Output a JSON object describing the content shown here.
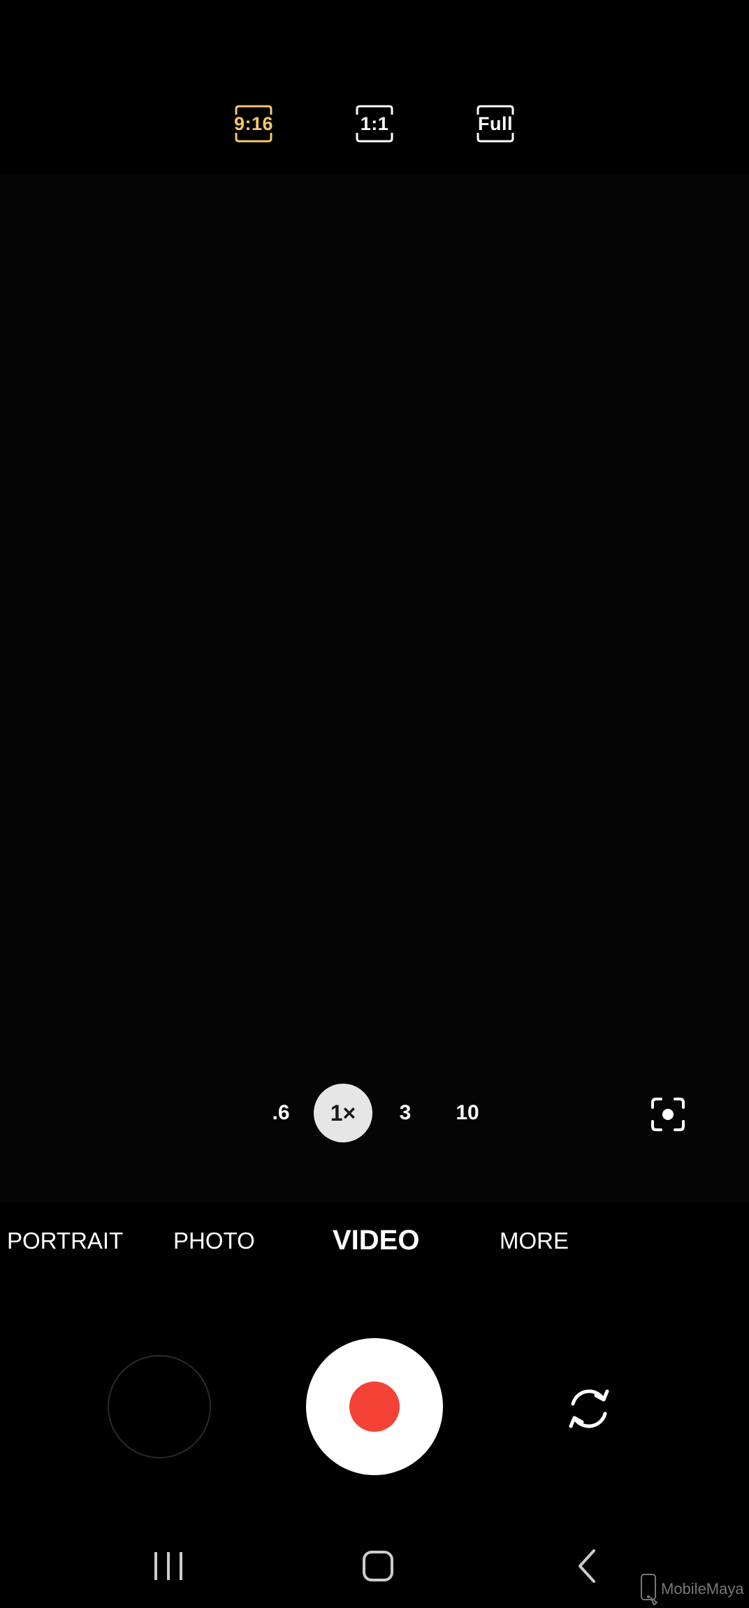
{
  "aspect_ratio": {
    "options": [
      {
        "label": "9:16",
        "selected": true
      },
      {
        "label": "1:1",
        "selected": false
      },
      {
        "label": "Full",
        "selected": false
      }
    ]
  },
  "zoom": {
    "levels": [
      ".6",
      "1×",
      "3",
      "10"
    ],
    "selected": "1×"
  },
  "modes": {
    "items": [
      "PORTRAIT",
      "PHOTO",
      "VIDEO",
      "MORE"
    ],
    "selected": "VIDEO"
  },
  "controls": {
    "record_icon": "record-icon",
    "switch_camera_icon": "switch-camera-icon",
    "focus_icon": "focus-target-icon",
    "gallery_icon": "gallery-thumbnail"
  },
  "navigation": {
    "recents_icon": "recents-icon",
    "home_icon": "home-icon",
    "back_icon": "back-icon"
  },
  "watermark": {
    "text": "MobileMaya"
  },
  "colors": {
    "accent_selected": "#f4c76a",
    "record_red": "#f44336",
    "background": "#000000"
  }
}
